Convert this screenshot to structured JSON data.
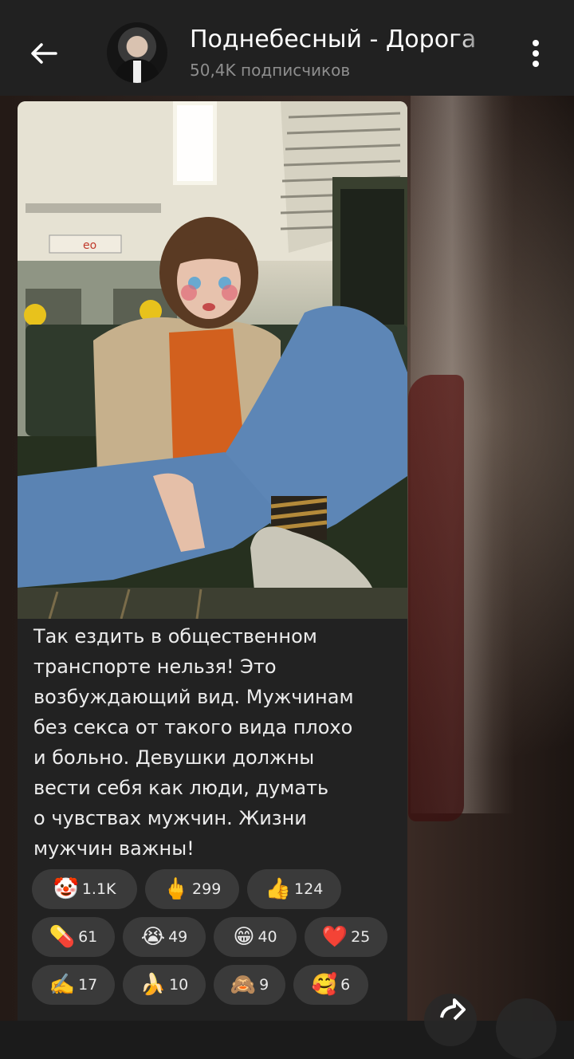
{
  "header": {
    "title": "Поднебесный - Дорога",
    "subscribers": "50,4K подписчиков"
  },
  "post": {
    "text": "Так ездить в общественном\nтранспорте нельзя! Это\nвозбуждающий вид. Мужчинам\nбез секса от такого вида плохо\nи больно. Девушки должны\nвести себя как люди, думать\nо чувствах мужчин. Жизни\nмужчин важны!"
  },
  "reactions": [
    {
      "emoji": "🤡",
      "count": "1.1K",
      "icon": "clown-icon"
    },
    {
      "emoji": "🖕",
      "count": "299",
      "icon": "middle-finger-icon"
    },
    {
      "emoji": "👍",
      "count": "124",
      "icon": "thumbs-up-icon"
    },
    {
      "emoji": "💊",
      "count": "61",
      "icon": "pill-icon"
    },
    {
      "emoji": "😭",
      "count": "49",
      "icon": "crying-face-icon"
    },
    {
      "emoji": "😁",
      "count": "40",
      "icon": "grinning-face-icon"
    },
    {
      "emoji": "❤️",
      "count": "25",
      "icon": "heart-icon"
    },
    {
      "emoji": "✍️",
      "count": "17",
      "icon": "writing-hand-icon"
    },
    {
      "emoji": "🍌",
      "count": "10",
      "icon": "banana-icon"
    },
    {
      "emoji": "🙈",
      "count": "9",
      "icon": "see-no-evil-monkey-icon"
    },
    {
      "emoji": "🥰",
      "count": "6",
      "icon": "smiling-face-hearts-icon"
    }
  ]
}
